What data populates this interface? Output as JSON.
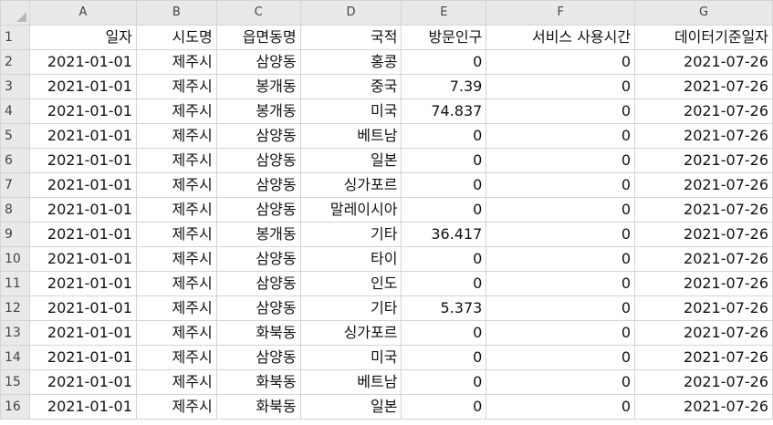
{
  "columns": [
    "A",
    "B",
    "C",
    "D",
    "E",
    "F",
    "G"
  ],
  "row_numbers": [
    "1",
    "2",
    "3",
    "4",
    "5",
    "6",
    "7",
    "8",
    "9",
    "10",
    "11",
    "12",
    "13",
    "14",
    "15",
    "16"
  ],
  "header_row": [
    "일자",
    "시도명",
    "읍면동명",
    "국적",
    "방문인구",
    "서비스 사용시간",
    "데이터기준일자"
  ],
  "rows": [
    [
      "2021-01-01",
      "제주시",
      "삼양동",
      "홍콩",
      "0",
      "0",
      "2021-07-26"
    ],
    [
      "2021-01-01",
      "제주시",
      "봉개동",
      "중국",
      "7.39",
      "0",
      "2021-07-26"
    ],
    [
      "2021-01-01",
      "제주시",
      "봉개동",
      "미국",
      "74.837",
      "0",
      "2021-07-26"
    ],
    [
      "2021-01-01",
      "제주시",
      "삼양동",
      "베트남",
      "0",
      "0",
      "2021-07-26"
    ],
    [
      "2021-01-01",
      "제주시",
      "삼양동",
      "일본",
      "0",
      "0",
      "2021-07-26"
    ],
    [
      "2021-01-01",
      "제주시",
      "삼양동",
      "싱가포르",
      "0",
      "0",
      "2021-07-26"
    ],
    [
      "2021-01-01",
      "제주시",
      "삼양동",
      "말레이시아",
      "0",
      "0",
      "2021-07-26"
    ],
    [
      "2021-01-01",
      "제주시",
      "봉개동",
      "기타",
      "36.417",
      "0",
      "2021-07-26"
    ],
    [
      "2021-01-01",
      "제주시",
      "삼양동",
      "타이",
      "0",
      "0",
      "2021-07-26"
    ],
    [
      "2021-01-01",
      "제주시",
      "삼양동",
      "인도",
      "0",
      "0",
      "2021-07-26"
    ],
    [
      "2021-01-01",
      "제주시",
      "삼양동",
      "기타",
      "5.373",
      "0",
      "2021-07-26"
    ],
    [
      "2021-01-01",
      "제주시",
      "화북동",
      "싱가포르",
      "0",
      "0",
      "2021-07-26"
    ],
    [
      "2021-01-01",
      "제주시",
      "삼양동",
      "미국",
      "0",
      "0",
      "2021-07-26"
    ],
    [
      "2021-01-01",
      "제주시",
      "화북동",
      "베트남",
      "0",
      "0",
      "2021-07-26"
    ],
    [
      "2021-01-01",
      "제주시",
      "화북동",
      "일본",
      "0",
      "0",
      "2021-07-26"
    ]
  ]
}
